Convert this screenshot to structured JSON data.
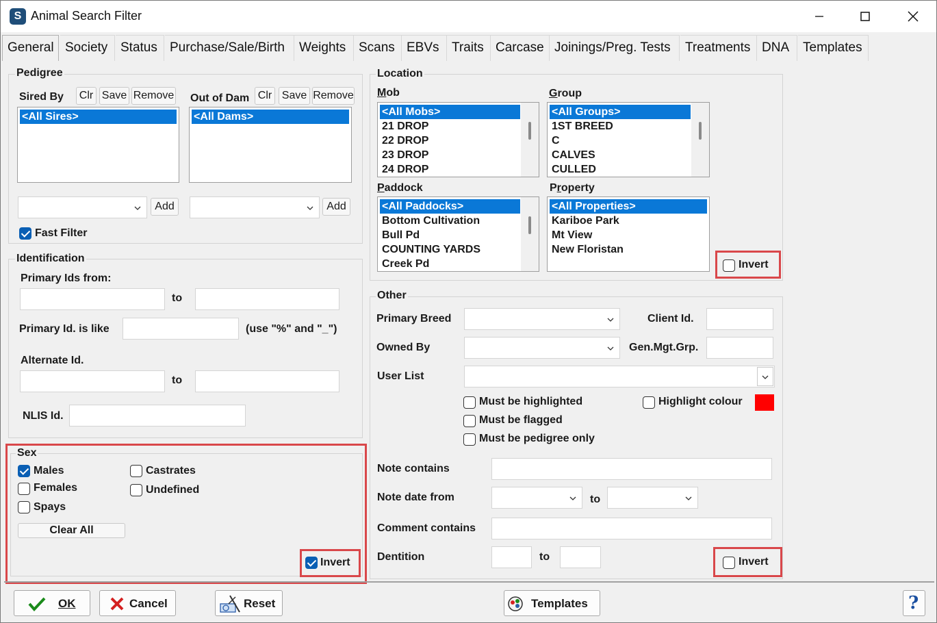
{
  "window": {
    "title": "Animal Search Filter"
  },
  "tabs": [
    "General",
    "Society",
    "Status",
    "Purchase/Sale/Birth",
    "Weights",
    "Scans",
    "EBVs",
    "Traits",
    "Carcase",
    "Joinings/Preg. Tests",
    "Treatments",
    "DNA",
    "Templates"
  ],
  "pedigree": {
    "title": "Pedigree",
    "sired_by": "Sired By",
    "out_of_dam": "Out of Dam",
    "clr": "Clr",
    "save": "Save",
    "remove": "Remove",
    "add": "Add",
    "sires_selected": "<All Sires>",
    "dams_selected": "<All Dams>",
    "fast_filter": "Fast Filter"
  },
  "identification": {
    "title": "Identification",
    "primary_from": "Primary Ids from:",
    "to": "to",
    "primary_like": "Primary Id. is like",
    "like_hint": "(use \"%\" and \"_\")",
    "alternate": "Alternate Id.",
    "nlis": "NLIS Id."
  },
  "sex": {
    "title": "Sex",
    "males": "Males",
    "females": "Females",
    "spays": "Spays",
    "castrates": "Castrates",
    "undefined": "Undefined",
    "clear_all": "Clear All",
    "invert": "Invert"
  },
  "location": {
    "title": "Location",
    "mob": "Mob",
    "mobs": [
      "<All Mobs>",
      "21 DROP",
      "22 DROP",
      "23 DROP",
      "24 DROP"
    ],
    "group": "Group",
    "groups": [
      "<All Groups>",
      "1ST BREED",
      "C",
      "CALVES",
      "CULLED"
    ],
    "paddock": "Paddock",
    "paddocks": [
      "<All Paddocks>",
      "Bottom Cultivation",
      "Bull Pd",
      "COUNTING YARDS",
      "Creek Pd"
    ],
    "property": "Property",
    "properties": [
      "<All Properties>",
      "Kariboe Park",
      "Mt View",
      "New Floristan"
    ],
    "invert": "Invert"
  },
  "other": {
    "title": "Other",
    "primary_breed": "Primary Breed",
    "client_id": "Client Id.",
    "owned_by": "Owned By",
    "gen_mgt_grp": "Gen.Mgt.Grp.",
    "user_list": "User List",
    "must_highlighted": "Must be highlighted",
    "highlight_colour": "Highlight colour",
    "highlight_color_value": "#ff0000",
    "must_flagged": "Must be flagged",
    "must_pedigree": "Must be pedigree only",
    "note_contains": "Note contains",
    "note_date_from": "Note date from",
    "to": "to",
    "comment_contains": "Comment contains",
    "dentition": "Dentition",
    "invert": "Invert"
  },
  "footer": {
    "ok": "OK",
    "cancel": "Cancel",
    "reset": "Reset",
    "templates": "Templates",
    "help": "?"
  }
}
